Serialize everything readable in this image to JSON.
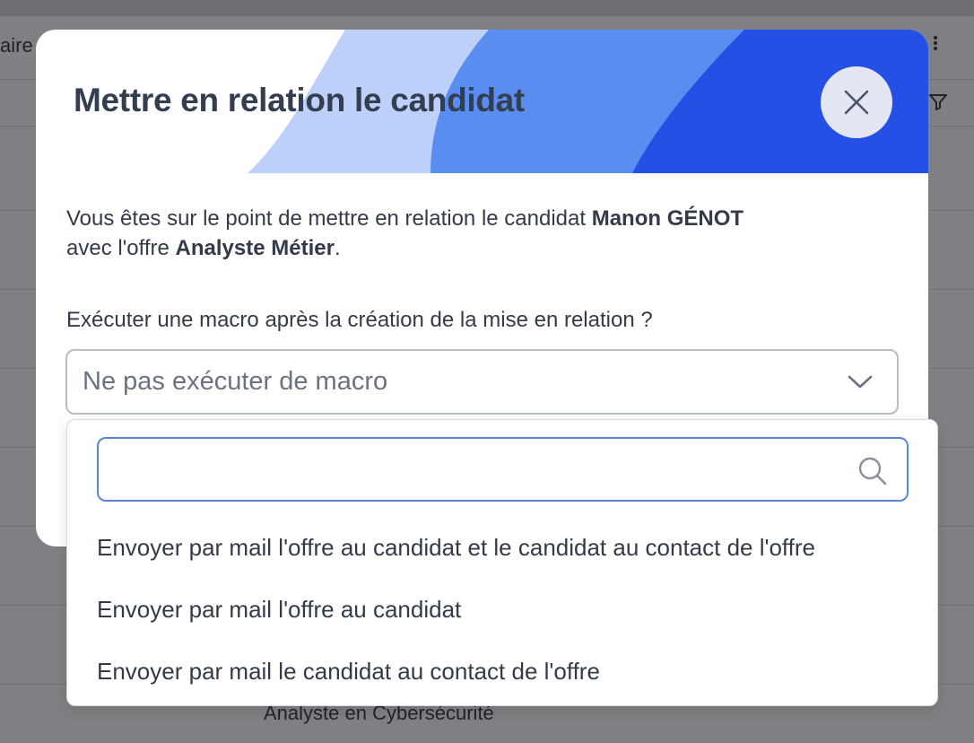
{
  "background": {
    "fragment_top_left": "aire",
    "fragment_bottom": "Analyste en Cybersécurité"
  },
  "modal": {
    "title": "Mettre en relation le candidat",
    "intro": {
      "prefix": "Vous êtes sur le point de mettre en relation le candidat ",
      "candidate": "Manon GÉNOT",
      "middle": "avec l'offre ",
      "offer": "Analyste Métier",
      "suffix": "."
    },
    "macro_label": "Exécuter une macro après la création de la mise en relation ?",
    "macro_select": {
      "value": "Ne pas exécuter de macro"
    },
    "close_icon": "close-icon"
  },
  "dropdown": {
    "search_placeholder": "",
    "search_icon": "search-icon",
    "options": [
      "Envoyer par mail l'offre au candidat et le candidat au contact de l'offre",
      "Envoyer par mail l'offre au candidat",
      "Envoyer par mail le candidat au contact de l'offre"
    ]
  },
  "colors": {
    "title": "#333e50",
    "wave_light": "#bcd0fa",
    "wave_mid": "#5a8df0",
    "wave_dark": "#2450e6",
    "search_border": "#5b86d6"
  }
}
